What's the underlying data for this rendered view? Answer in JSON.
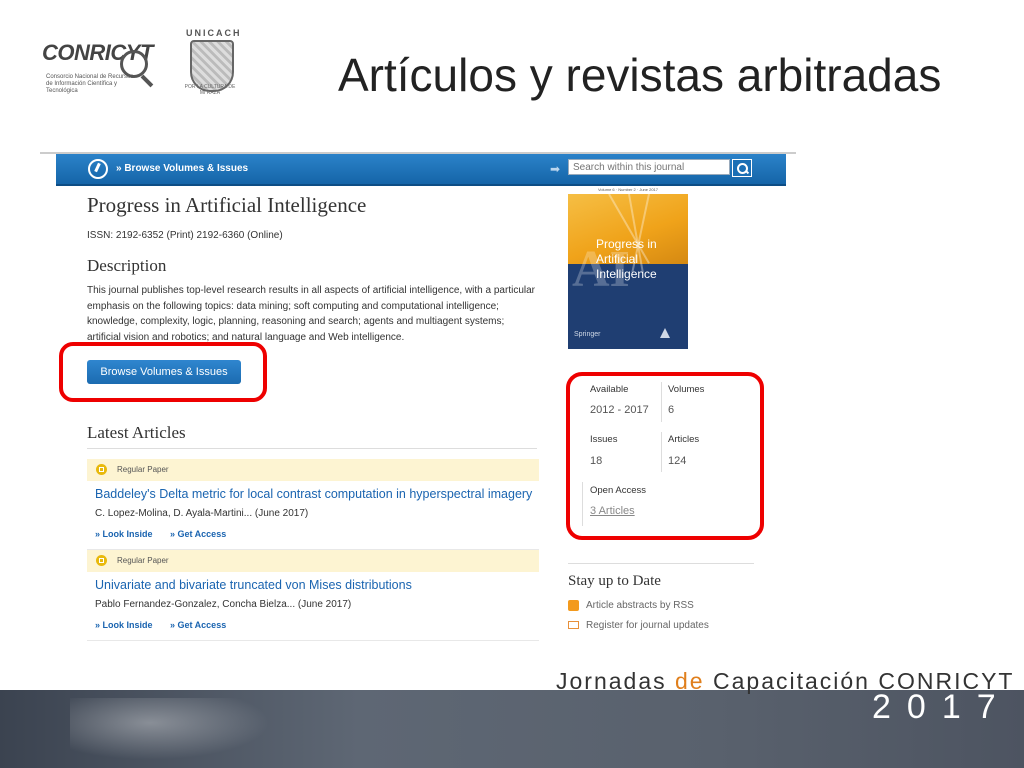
{
  "slide": {
    "title": "Artículos y revistas arbitradas",
    "logo_left": {
      "name": "CONRICYT",
      "subtitle": "Consorcio Nacional de Recursos de Información Científica y Tecnológica"
    },
    "logo_right": {
      "name": "UNICACH",
      "ring": "POR LA CULTURA DE MI RAZA"
    },
    "footer": {
      "prefix": "Jornadas ",
      "accent": "de",
      "middle": " Capacitación ",
      "brand": "CONRICYT",
      "year": "2017"
    }
  },
  "navbar": {
    "link_label": "» Browse Volumes & Issues",
    "search_placeholder": "Search within this journal",
    "search_icon": "search-icon"
  },
  "journal": {
    "title": "Progress in Artificial Intelligence",
    "issn": "ISSN: 2192-6352 (Print) 2192-6360 (Online)",
    "description_heading": "Description",
    "description": "This journal publishes top-level research results in all aspects of artificial intelligence, with a particular emphasis on the following topics: data mining; soft computing and computational intelligence; knowledge, complexity, logic, planning, reasoning and search; agents and multiagent systems; artificial vision and robotics; and natural language and Web intelligence.",
    "browse_button": "Browse Volumes & Issues"
  },
  "latest": {
    "heading": "Latest Articles",
    "articles": [
      {
        "type": "Regular Paper",
        "title": "Baddeley's Delta metric for local contrast computation in hyperspectral imagery",
        "authors": "C. Lopez-Molina, D. Ayala-Martini... (June 2017)",
        "look_inside": "» Look Inside",
        "get_access": "» Get Access"
      },
      {
        "type": "Regular Paper",
        "title": "Univariate and bivariate truncated von Mises distributions",
        "authors": "Pablo Fernandez-Gonzalez, Concha Bielza... (June 2017)",
        "look_inside": "» Look Inside",
        "get_access": "» Get Access"
      }
    ]
  },
  "cover": {
    "line1": "Progress in",
    "line2": "Artificial",
    "line3": "Intelligence",
    "big_letters": "AI",
    "publisher": "Springer",
    "band": "Volume 6 · Number 2 · June 2017"
  },
  "stats": {
    "available_label": "Available",
    "available_value": "2012 - 2017",
    "volumes_label": "Volumes",
    "volumes_value": "6",
    "issues_label": "Issues",
    "issues_value": "18",
    "articles_label": "Articles",
    "articles_value": "124",
    "open_access_label": "Open Access",
    "open_access_value": "3 Articles"
  },
  "stay": {
    "heading": "Stay up to Date",
    "rss": "Article abstracts by RSS",
    "register": "Register for journal updates"
  },
  "colors": {
    "nav_blue": "#1a6fb5",
    "link_blue": "#1a64b0",
    "highlight_red": "#e00000",
    "accent_orange": "#e07f1c"
  }
}
